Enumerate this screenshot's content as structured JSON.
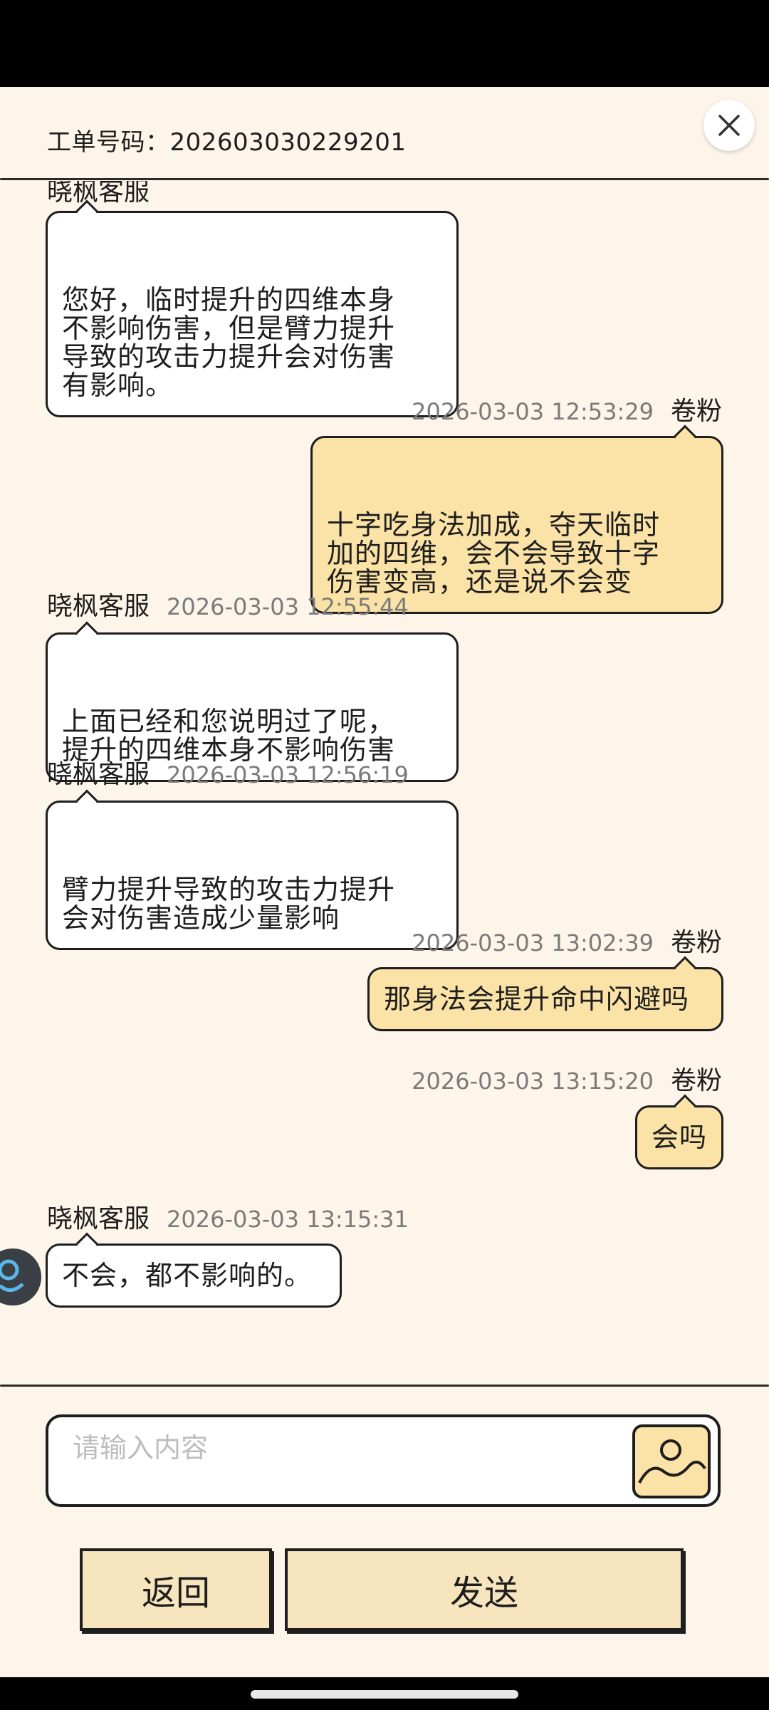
{
  "header": {
    "ticket_label": "工单号码：202603030229201"
  },
  "messages": [
    {
      "side": "agent",
      "sender": "晓枫客服",
      "time": "",
      "text": "您好，临时提升的四维本身\n不影响伤害，但是臂力提升\n导致的攻击力提升会对伤害\n有影响。"
    },
    {
      "side": "user",
      "sender": "卷粉",
      "time": "2026-03-03 12:53:29",
      "text": "十字吃身法加成，夺天临时\n加的四维，会不会导致十字\n伤害变高，还是说不会变"
    },
    {
      "side": "agent",
      "sender": "晓枫客服",
      "time": "2026-03-03 12:55:44",
      "text": "上面已经和您说明过了呢，\n提升的四维本身不影响伤害"
    },
    {
      "side": "agent",
      "sender": "晓枫客服",
      "time": "2026-03-03 12:56:19",
      "text": "臂力提升导致的攻击力提升\n会对伤害造成少量影响"
    },
    {
      "side": "user",
      "sender": "卷粉",
      "time": "2026-03-03 13:02:39",
      "text": "那身法会提升命中闪避吗"
    },
    {
      "side": "user",
      "sender": "卷粉",
      "time": "2026-03-03 13:15:20",
      "text": "会吗"
    },
    {
      "side": "agent",
      "sender": "晓枫客服",
      "time": "2026-03-03 13:15:31",
      "text": "不会，都不影响的。"
    }
  ],
  "input": {
    "placeholder": "请输入内容"
  },
  "buttons": {
    "back_label": "返回",
    "send_label": "发送"
  },
  "icons": {
    "close": "close-icon",
    "image": "image-icon"
  },
  "colors": {
    "background": "#fdf5ea",
    "user_bubble": "#fbe2a6",
    "agent_bubble": "#ffffff",
    "button": "#f7e6bd"
  }
}
